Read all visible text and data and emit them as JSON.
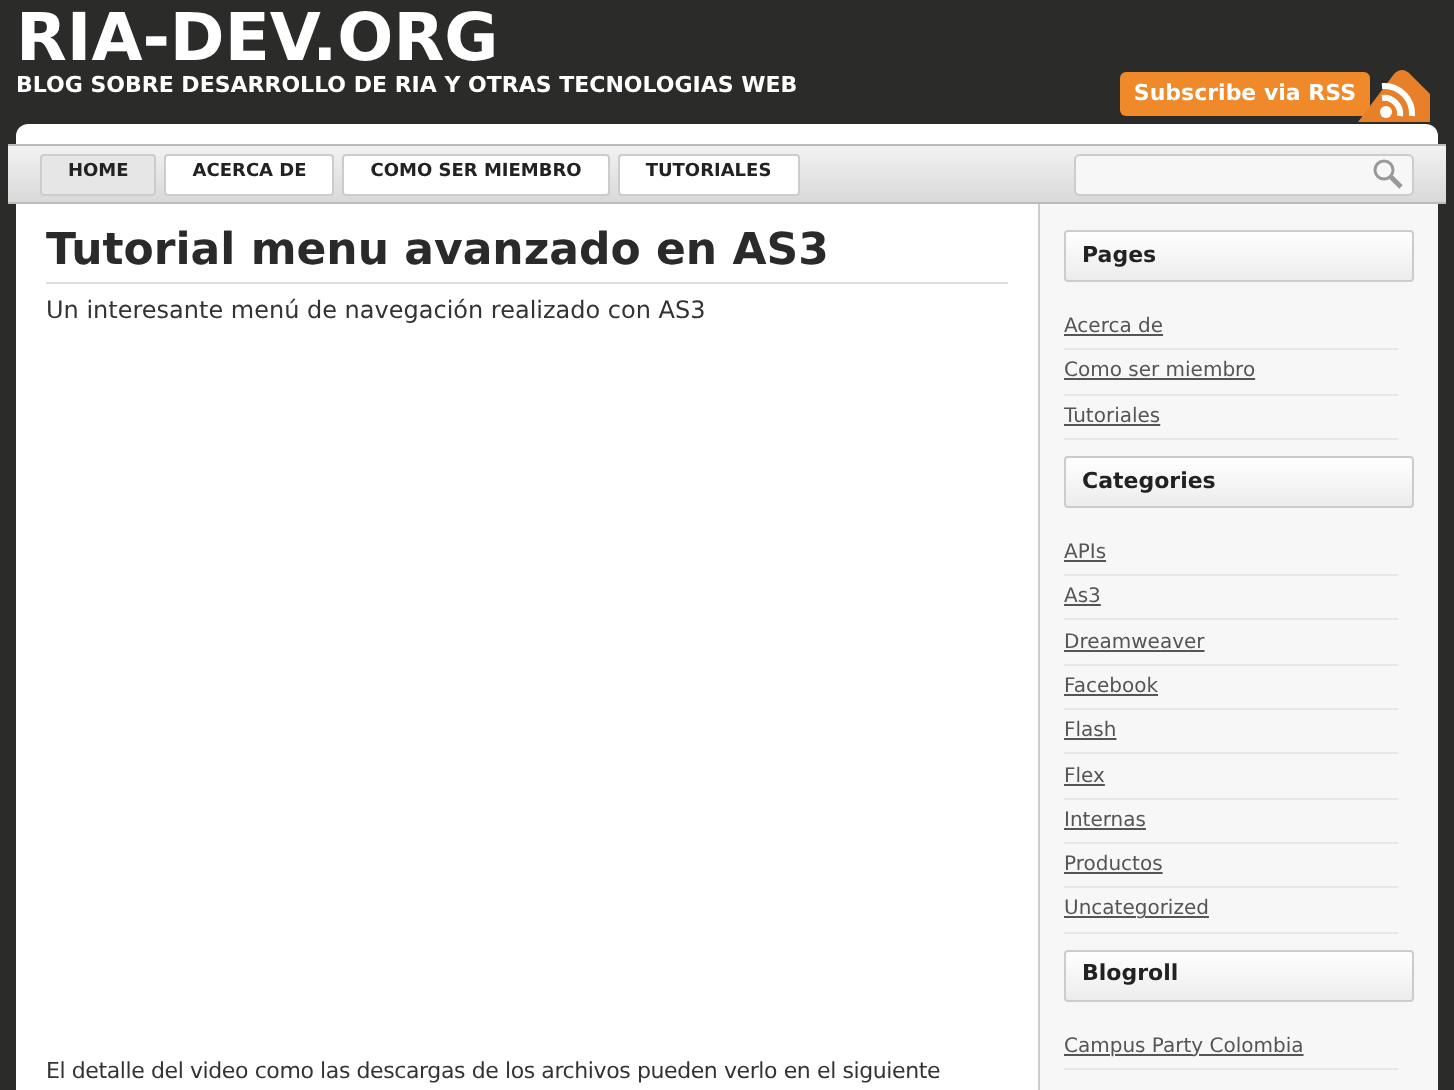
{
  "site": {
    "title": "RIA-DEV.ORG",
    "tagline": "BLOG SOBRE DESARROLLO DE RIA Y OTRAS TECNOLOGIAS WEB",
    "rss": "Subscribe via RSS"
  },
  "nav": [
    {
      "label": "HOME",
      "selected": true
    },
    {
      "label": "ACERCA DE",
      "selected": false
    },
    {
      "label": "COMO SER MIEMBRO",
      "selected": false
    },
    {
      "label": "TUTORIALES",
      "selected": false
    }
  ],
  "post": {
    "title": "Tutorial menu avanzado en AS3",
    "intro": "Un interesante menú de navegación realizado con AS3",
    "body": "El detalle del video como las descargas de los archivos pueden verlo en el siguiente"
  },
  "sidebar": [
    {
      "title": "Pages",
      "items": [
        "Acerca de",
        "Como ser miembro",
        "Tutoriales"
      ]
    },
    {
      "title": "Categories",
      "items": [
        "APIs",
        "As3",
        "Dreamweaver",
        "Facebook",
        "Flash",
        "Flex",
        "Internas",
        "Productos",
        "Uncategorized"
      ]
    },
    {
      "title": "Blogroll",
      "items": [
        "Campus Party Colombia"
      ]
    }
  ]
}
